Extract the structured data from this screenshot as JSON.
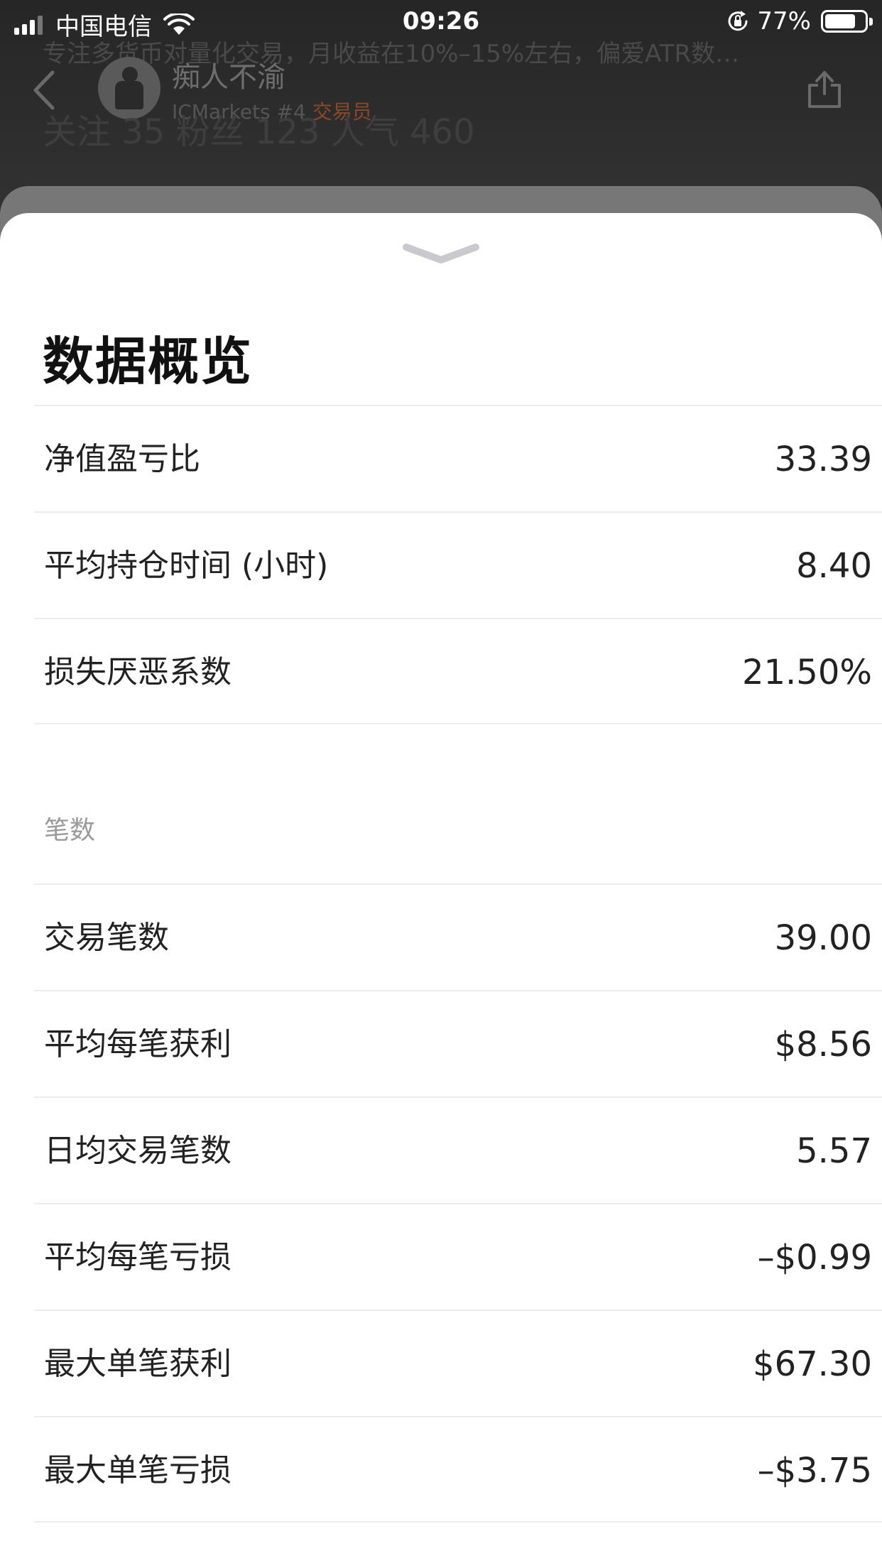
{
  "status_bar": {
    "carrier": "中国电信",
    "time": "09:26",
    "battery_text": "77%",
    "battery_level": 0.77
  },
  "background_profile": {
    "description": "专注多货币对量化交易，月收益在10%–15%左右，偏爱ATR数…",
    "name": "痴人不渝",
    "broker_rank": "ICMarkets #4",
    "role": "交易员",
    "stats": "关注 35   粉丝 123   人气 460"
  },
  "sheet": {
    "title": "数据概览",
    "overview_rows": [
      {
        "label": "净值盈亏比",
        "value": "33.39"
      },
      {
        "label": "平均持仓时间 (小时)",
        "value": "8.40"
      },
      {
        "label": "损失厌恶系数",
        "value": "21.50%"
      }
    ],
    "section_title": "笔数",
    "count_rows": [
      {
        "label": "交易笔数",
        "value": "39.00"
      },
      {
        "label": "平均每笔获利",
        "value": "$8.56"
      },
      {
        "label": "日均交易笔数",
        "value": "5.57"
      },
      {
        "label": "平均每笔亏损",
        "value": "–$0.99"
      },
      {
        "label": "最大单笔获利",
        "value": "$67.30"
      },
      {
        "label": "最大单笔亏损",
        "value": "–$3.75"
      }
    ]
  }
}
